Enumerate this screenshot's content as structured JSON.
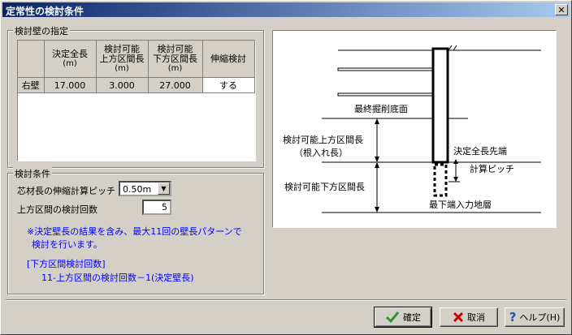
{
  "window": {
    "title": "定常性の検討条件",
    "close_glyph": "✕"
  },
  "group_wall": {
    "legend": "検討壁の指定",
    "table": {
      "headers": [
        {
          "line1": "",
          "line2": "",
          "line3": ""
        },
        {
          "line1": "決定全長",
          "line2": "(m)",
          "line3": ""
        },
        {
          "line1": "検討可能",
          "line2": "上方区間長",
          "line3": "(m)"
        },
        {
          "line1": "検討可能",
          "line2": "下方区間長",
          "line3": "(m)"
        },
        {
          "line1": "伸縮検討",
          "line2": "",
          "line3": ""
        }
      ],
      "rows": [
        {
          "name": "右壁",
          "length": "17.000",
          "upper": "3.000",
          "lower": "27.000",
          "flag": "する"
        }
      ]
    }
  },
  "group_cond": {
    "legend": "検討条件",
    "pitch_label": "芯材長の伸縮計算ピッチ",
    "pitch_value": "0.50m",
    "count_label": "上方区間の検討回数",
    "count_value": "5",
    "note1": "※決定壁長の結果を含み、最大11回の壁長パターンで",
    "note2": "検討を行います。",
    "note3": "[下方区間検討回数]",
    "note4": "11-上方区間の検討回数－1(決定壁長)"
  },
  "diagram": {
    "label_excavation": "最終掘削底面",
    "label_upper1": "検討可能上方区間長",
    "label_upper2": "（根入れ長）",
    "label_tip": "決定全長先端",
    "label_pitch": "計算ピッチ",
    "label_lower": "検討可能下方区間長",
    "label_bottom": "最下端入力地層"
  },
  "buttons": {
    "ok": "確定",
    "cancel": "取消",
    "help": "ヘルプ(H)"
  },
  "colors": {
    "ok_icon": "#2e9a2e",
    "cancel_icon": "#cc0000",
    "help_icon": "#1e50b4",
    "note": "#0000ff"
  }
}
